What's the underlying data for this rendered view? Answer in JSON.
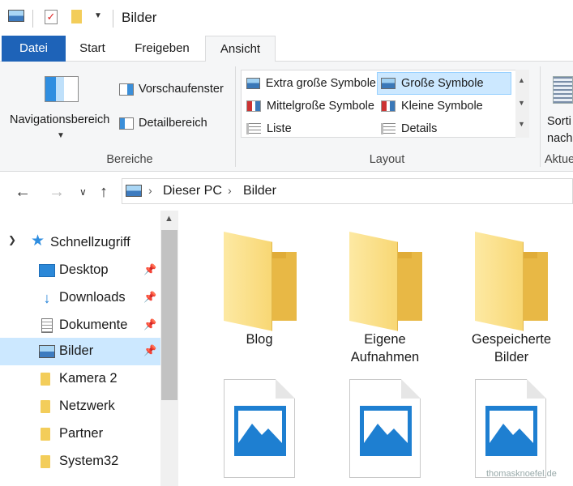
{
  "window": {
    "title": "Bilder"
  },
  "tabs": {
    "file": "Datei",
    "start": "Start",
    "share": "Freigeben",
    "view": "Ansicht"
  },
  "ribbon": {
    "areas": {
      "nav_pane": "Navigationsbereich",
      "preview": "Vorschaufenster",
      "details": "Detailbereich",
      "label": "Bereiche"
    },
    "layout": {
      "items": [
        "Extra große Symbole",
        "Große Symbole",
        "Mittelgroße Symbole",
        "Kleine Symbole",
        "Liste",
        "Details"
      ],
      "selected": "Große Symbole",
      "label": "Layout"
    },
    "sort": {
      "line1": "Sorti",
      "line2": "nach",
      "group_label": "Aktue"
    }
  },
  "address": {
    "crumbs": [
      "Dieser PC",
      "Bilder"
    ]
  },
  "navpane": {
    "quick_access": "Schnellzugriff",
    "items": [
      {
        "label": "Desktop",
        "icon": "desktop-icon",
        "pinned": true
      },
      {
        "label": "Downloads",
        "icon": "download-icon",
        "pinned": true
      },
      {
        "label": "Dokumente",
        "icon": "document-icon",
        "pinned": true
      },
      {
        "label": "Bilder",
        "icon": "pictures-icon",
        "pinned": true,
        "selected": true
      },
      {
        "label": "Kamera 2",
        "icon": "folder-icon",
        "pinned": false
      },
      {
        "label": "Netzwerk",
        "icon": "folder-icon",
        "pinned": false
      },
      {
        "label": "Partner",
        "icon": "folder-icon",
        "pinned": false
      },
      {
        "label": "System32",
        "icon": "folder-icon",
        "pinned": false
      }
    ]
  },
  "content": {
    "folders": [
      {
        "line1": "Blog",
        "line2": ""
      },
      {
        "line1": "Eigene",
        "line2": "Aufnahmen"
      },
      {
        "line1": "Gespeicherte",
        "line2": "Bilder"
      }
    ],
    "files": [
      "image-file-1",
      "image-file-2",
      "image-file-3"
    ]
  },
  "watermark": "thomasknoefel.de",
  "colors": {
    "accent": "#1e63b8",
    "selection": "#cce8ff",
    "folder": "#f8d774"
  }
}
